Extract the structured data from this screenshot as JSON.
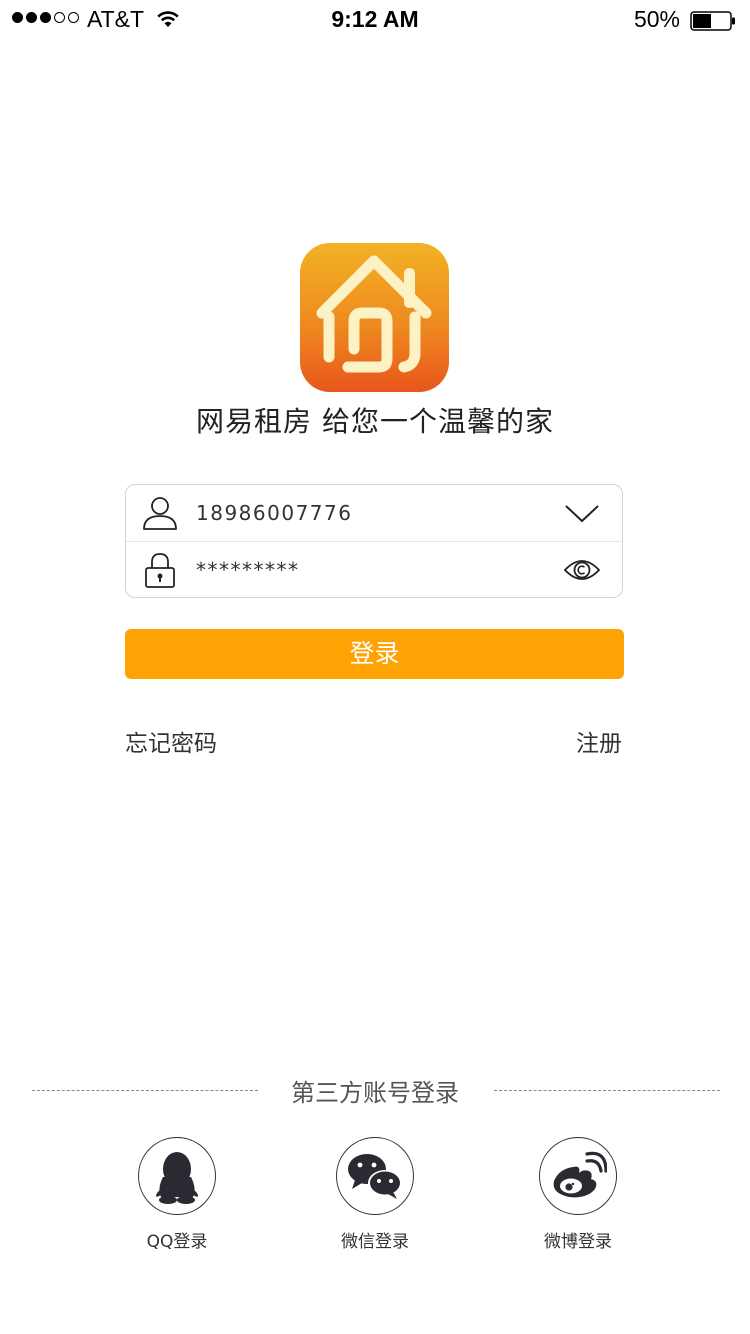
{
  "status_bar": {
    "carrier": "AT&T",
    "time": "9:12 AM",
    "battery": "50%",
    "battery_level": 0.5,
    "signal_bars_filled": 3,
    "signal_bars_total": 5
  },
  "app": {
    "logo_icon": "house-logo-icon",
    "slogan": "网易租房 给您一个温馨的家"
  },
  "form": {
    "phone_value": "18986007776",
    "password_value": "*********",
    "user_icon": "user-icon",
    "lock_icon": "lock-icon",
    "dropdown_icon": "chevron-down-icon",
    "eye_icon": "eye-icon"
  },
  "actions": {
    "login_label": "登录",
    "forgot_label": "忘记密码",
    "register_label": "注册"
  },
  "third_party": {
    "title": "第三方账号登录",
    "providers": [
      {
        "icon": "qq-icon",
        "label": "QQ登录"
      },
      {
        "icon": "wechat-icon",
        "label": "微信登录"
      },
      {
        "icon": "weibo-icon",
        "label": "微博登录"
      }
    ]
  },
  "colors": {
    "accent": "#fda404",
    "logo_top": "#f2b224",
    "logo_bottom": "#e8561c"
  }
}
